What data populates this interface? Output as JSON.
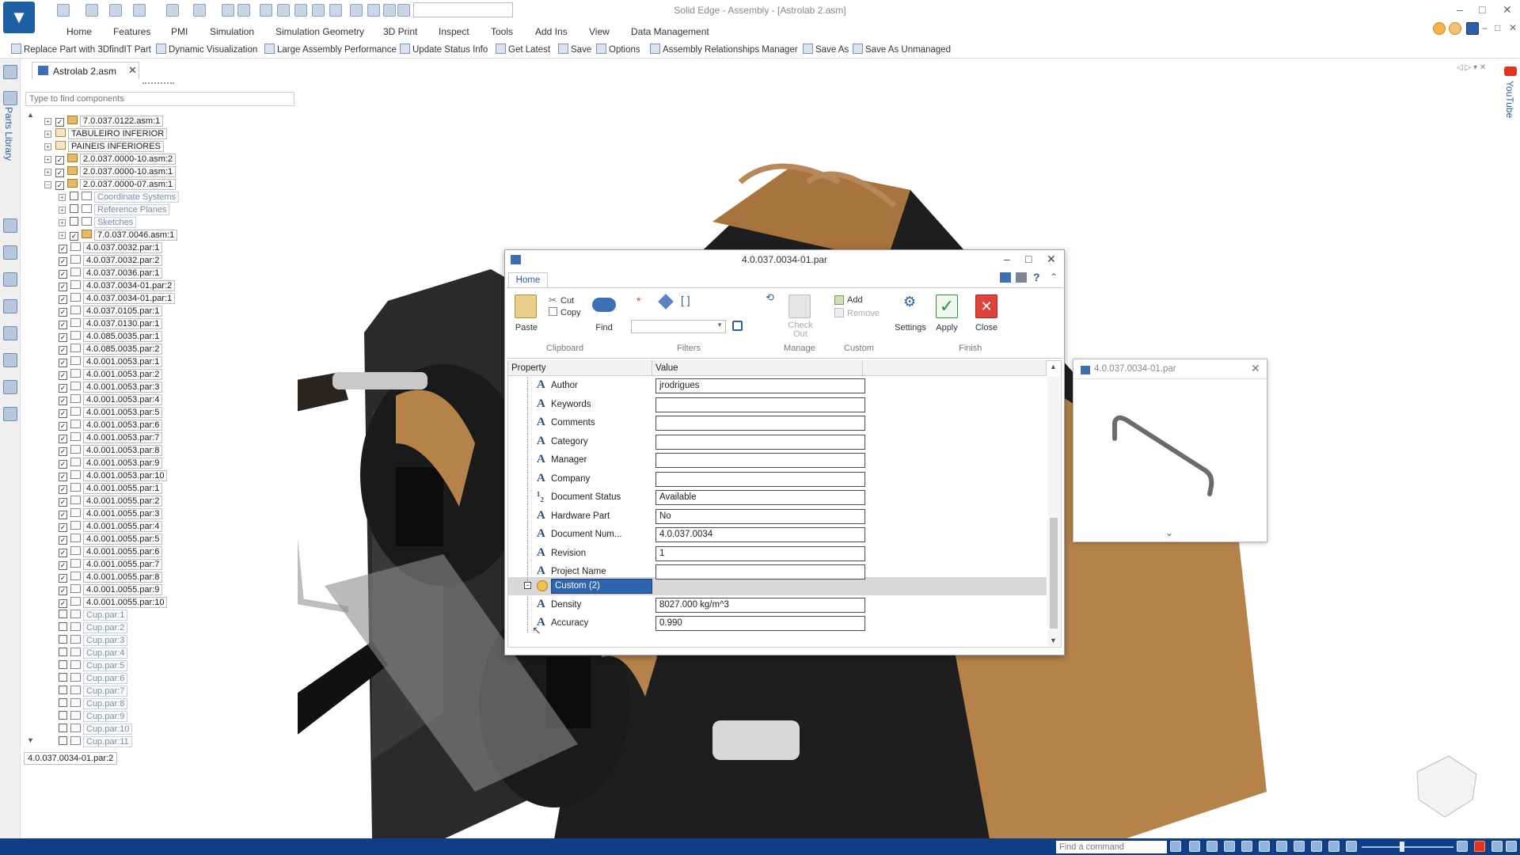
{
  "app": {
    "title": "Solid Edge - Assembly - [Astrolab 2.asm]",
    "logo_glyph": "▼",
    "window_controls": [
      "–",
      "□",
      "✕"
    ],
    "inner_controls": [
      "–",
      "□",
      "✕"
    ]
  },
  "menu": [
    "Home",
    "Features",
    "PMI",
    "Simulation",
    "Simulation Geometry",
    "3D Print",
    "Inspect",
    "Tools",
    "Add Ins",
    "View",
    "Data Management"
  ],
  "ribbon_commands": [
    {
      "label": "Replace Part with 3DfindIT Part",
      "icon": "replace-part-icon"
    },
    {
      "label": "Dynamic Visualization",
      "icon": "dynamic-visualization-icon"
    },
    {
      "label": "Large Assembly Performance",
      "icon": "large-assembly-icon"
    },
    {
      "label": "Update Status Info",
      "icon": "update-status-icon"
    },
    {
      "label": "Get Latest",
      "icon": "get-latest-icon"
    },
    {
      "label": "Save",
      "icon": "save-icon"
    },
    {
      "label": "Options",
      "icon": "options-icon"
    },
    {
      "label": "Assembly Relationships Manager",
      "icon": "relationships-icon"
    },
    {
      "label": "Save As",
      "icon": "save-as-icon"
    },
    {
      "label": "Save As Unmanaged",
      "icon": "save-as-unmanaged-icon"
    }
  ],
  "doc_tab": {
    "label": "Astrolab 2.asm",
    "close": "✕"
  },
  "left_strip": {
    "label": "Parts Library"
  },
  "right_strip": {
    "label": "YouTube"
  },
  "pathfinder": {
    "search_placeholder": "Type to find components",
    "tree": [
      {
        "label": "7.0.037.0122.asm:1",
        "level": 0,
        "checked": true,
        "type": "asm",
        "dim": false
      },
      {
        "label": "TABULEIRO INFERIOR",
        "level": 0,
        "checked": null,
        "type": "grp",
        "dim": false
      },
      {
        "label": "PAINEIS INFERIORES",
        "level": 0,
        "checked": null,
        "type": "grp",
        "dim": false
      },
      {
        "label": "2.0.037.0000-10.asm:2",
        "level": 0,
        "checked": true,
        "type": "asm",
        "dim": false
      },
      {
        "label": "2.0.037.0000-10.asm:1",
        "level": 0,
        "checked": true,
        "type": "asm",
        "dim": false
      },
      {
        "label": "2.0.037.0000-07.asm:1",
        "level": 0,
        "checked": true,
        "type": "asm",
        "dim": false,
        "expanded": true
      },
      {
        "label": "Coordinate Systems",
        "level": 1,
        "checked": false,
        "type": "par",
        "dim": true
      },
      {
        "label": "Reference Planes",
        "level": 1,
        "checked": false,
        "type": "par",
        "dim": true
      },
      {
        "label": "Sketches",
        "level": 1,
        "checked": false,
        "type": "par",
        "dim": true
      },
      {
        "label": "7.0.037.0046.asm:1",
        "level": 1,
        "checked": true,
        "type": "asm",
        "dim": false
      },
      {
        "label": "4.0.037.0032.par:1",
        "level": 1,
        "checked": true,
        "type": "par",
        "dim": false
      },
      {
        "label": "4.0.037.0032.par:2",
        "level": 1,
        "checked": true,
        "type": "par",
        "dim": false
      },
      {
        "label": "4.0.037.0036.par:1",
        "level": 1,
        "checked": true,
        "type": "par",
        "dim": false
      },
      {
        "label": "4.0.037.0034-01.par:2",
        "level": 1,
        "checked": true,
        "type": "par",
        "dim": false
      },
      {
        "label": "4.0.037.0034-01.par:1",
        "level": 1,
        "checked": true,
        "type": "par",
        "dim": false
      },
      {
        "label": "4.0.037.0105.par:1",
        "level": 1,
        "checked": true,
        "type": "par",
        "dim": false
      },
      {
        "label": "4.0.037.0130.par:1",
        "level": 1,
        "checked": true,
        "type": "par",
        "dim": false
      },
      {
        "label": "4.0.085.0035.par:1",
        "level": 1,
        "checked": true,
        "type": "par",
        "dim": false
      },
      {
        "label": "4.0.085.0035.par:2",
        "level": 1,
        "checked": true,
        "type": "par",
        "dim": false
      },
      {
        "label": "4.0.001.0053.par:1",
        "level": 1,
        "checked": true,
        "type": "par",
        "dim": false
      },
      {
        "label": "4.0.001.0053.par:2",
        "level": 1,
        "checked": true,
        "type": "par",
        "dim": false
      },
      {
        "label": "4.0.001.0053.par:3",
        "level": 1,
        "checked": true,
        "type": "par",
        "dim": false
      },
      {
        "label": "4.0.001.0053.par:4",
        "level": 1,
        "checked": true,
        "type": "par",
        "dim": false
      },
      {
        "label": "4.0.001.0053.par:5",
        "level": 1,
        "checked": true,
        "type": "par",
        "dim": false
      },
      {
        "label": "4.0.001.0053.par:6",
        "level": 1,
        "checked": true,
        "type": "par",
        "dim": false
      },
      {
        "label": "4.0.001.0053.par:7",
        "level": 1,
        "checked": true,
        "type": "par",
        "dim": false
      },
      {
        "label": "4.0.001.0053.par:8",
        "level": 1,
        "checked": true,
        "type": "par",
        "dim": false
      },
      {
        "label": "4.0.001.0053.par:9",
        "level": 1,
        "checked": true,
        "type": "par",
        "dim": false
      },
      {
        "label": "4.0.001.0053.par:10",
        "level": 1,
        "checked": true,
        "type": "par",
        "dim": false
      },
      {
        "label": "4.0.001.0055.par:1",
        "level": 1,
        "checked": true,
        "type": "par",
        "dim": false
      },
      {
        "label": "4.0.001.0055.par:2",
        "level": 1,
        "checked": true,
        "type": "par",
        "dim": false
      },
      {
        "label": "4.0.001.0055.par:3",
        "level": 1,
        "checked": true,
        "type": "par",
        "dim": false
      },
      {
        "label": "4.0.001.0055.par:4",
        "level": 1,
        "checked": true,
        "type": "par",
        "dim": false
      },
      {
        "label": "4.0.001.0055.par:5",
        "level": 1,
        "checked": true,
        "type": "par",
        "dim": false
      },
      {
        "label": "4.0.001.0055.par:6",
        "level": 1,
        "checked": true,
        "type": "par",
        "dim": false
      },
      {
        "label": "4.0.001.0055.par:7",
        "level": 1,
        "checked": true,
        "type": "par",
        "dim": false
      },
      {
        "label": "4.0.001.0055.par:8",
        "level": 1,
        "checked": true,
        "type": "par",
        "dim": false
      },
      {
        "label": "4.0.001.0055.par:9",
        "level": 1,
        "checked": true,
        "type": "par",
        "dim": false
      },
      {
        "label": "4.0.001.0055.par:10",
        "level": 1,
        "checked": true,
        "type": "par",
        "dim": false
      },
      {
        "label": "Cup.par:1",
        "level": 1,
        "checked": false,
        "type": "par",
        "dim": true
      },
      {
        "label": "Cup.par:2",
        "level": 1,
        "checked": false,
        "type": "par",
        "dim": true
      },
      {
        "label": "Cup.par:3",
        "level": 1,
        "checked": false,
        "type": "par",
        "dim": true
      },
      {
        "label": "Cup.par:4",
        "level": 1,
        "checked": false,
        "type": "par",
        "dim": true
      },
      {
        "label": "Cup.par:5",
        "level": 1,
        "checked": false,
        "type": "par",
        "dim": true
      },
      {
        "label": "Cup.par:6",
        "level": 1,
        "checked": false,
        "type": "par",
        "dim": true
      },
      {
        "label": "Cup.par:7",
        "level": 1,
        "checked": false,
        "type": "par",
        "dim": true
      },
      {
        "label": "Cup.par:8",
        "level": 1,
        "checked": false,
        "type": "par",
        "dim": true
      },
      {
        "label": "Cup.par:9",
        "level": 1,
        "checked": false,
        "type": "par",
        "dim": true
      },
      {
        "label": "Cup.par:10",
        "level": 1,
        "checked": false,
        "type": "par",
        "dim": true
      },
      {
        "label": "Cup.par:11",
        "level": 1,
        "checked": false,
        "type": "par",
        "dim": true
      }
    ],
    "status_item": "4.0.037.0034-01.par:2"
  },
  "dialog": {
    "title": "4.0.037.0034-01.par",
    "tab": "Home",
    "buttons": {
      "paste": "Paste",
      "cut": "Cut",
      "copy": "Copy",
      "find": "Find",
      "check_out": "Check Out",
      "add": "Add",
      "remove": "Remove",
      "settings": "Settings",
      "apply": "Apply",
      "close": "Close"
    },
    "groups": [
      "Clipboard",
      "Filters",
      "Manage",
      "Custom",
      "Finish"
    ],
    "columns": {
      "property": "Property",
      "value": "Value"
    },
    "properties": [
      {
        "name": "Author",
        "value": "jrodrigues",
        "type_glyph": "A"
      },
      {
        "name": "Keywords",
        "value": "",
        "type_glyph": "A"
      },
      {
        "name": "Comments",
        "value": "",
        "type_glyph": "A"
      },
      {
        "name": "Category",
        "value": "",
        "type_glyph": "A"
      },
      {
        "name": "Manager",
        "value": "",
        "type_glyph": "A"
      },
      {
        "name": "Company",
        "value": "",
        "type_glyph": "A"
      },
      {
        "name": "Document Status",
        "value": "Available",
        "type_glyph": "¹₂"
      },
      {
        "name": "Hardware Part",
        "value": "No",
        "type_glyph": "A"
      },
      {
        "name": "Document Num...",
        "value": "4.0.037.0034",
        "type_glyph": "A"
      },
      {
        "name": "Revision",
        "value": "1",
        "type_glyph": "A"
      },
      {
        "name": "Project Name",
        "value": "",
        "type_glyph": "A"
      }
    ],
    "custom_group": "Custom (2)",
    "custom_properties": [
      {
        "name": "Density",
        "value": "8027.000 kg/m^3",
        "type_glyph": "A"
      },
      {
        "name": "Accuracy",
        "value": "0.990",
        "type_glyph": "A"
      }
    ]
  },
  "preview": {
    "title": "4.0.037.0034-01.par",
    "close": "✕",
    "chevron": "⌵"
  },
  "statusbar": {
    "command_placeholder": "Find a command"
  },
  "colors": {
    "accent": "#2f64b0",
    "statusbar": "#0e3f86",
    "close_button": "#e0423a",
    "apply_check": "#2e8b3d",
    "bronze": "#b5824a"
  }
}
